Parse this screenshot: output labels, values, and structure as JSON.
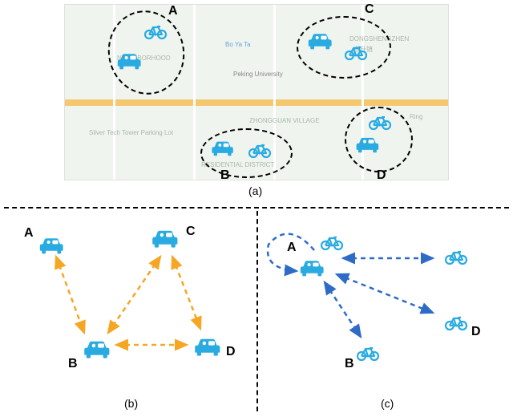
{
  "panel_a": {
    "caption": "(a)",
    "map_labels": {
      "boyata": "Bo Ya Ta",
      "pku": "Peking University",
      "silver": "Silver Tech Tower Parking Lot",
      "neighborhood": "NEIGHBORHOOD",
      "zhongguan": "ZHONGGUAN VILLAGE",
      "residential": "RESIDENTIAL DISTRICT",
      "dongshengzhen": "DONGSHENGZHEN",
      "ring": "Ring",
      "dongshengcn": "东升镇"
    },
    "clusters": {
      "A": {
        "label": "A"
      },
      "B": {
        "label": "B"
      },
      "C": {
        "label": "C"
      },
      "D": {
        "label": "D"
      }
    }
  },
  "panel_b": {
    "caption": "(b)",
    "nodes": {
      "A": "A",
      "B": "B",
      "C": "C",
      "D": "D"
    }
  },
  "panel_c": {
    "caption": "(c)",
    "nodes": {
      "A": "A",
      "B": "B",
      "D": "D"
    }
  },
  "colors": {
    "icon": "#29abe2",
    "edge_orange": "#f5a623",
    "edge_blue": "#2e6bc7"
  }
}
